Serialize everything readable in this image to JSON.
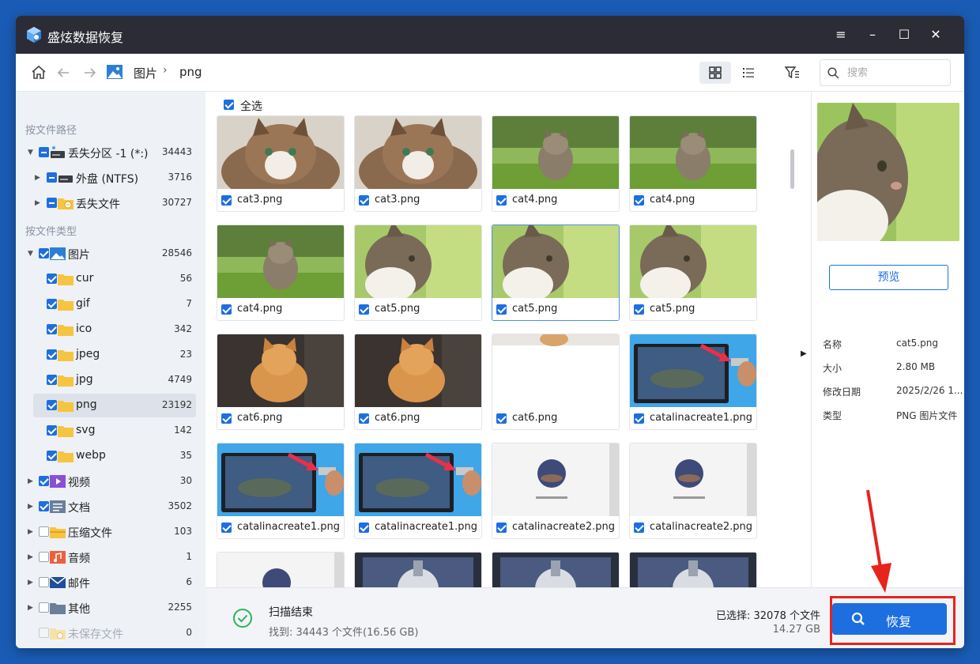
{
  "window": {
    "title": "盛炫数据恢复",
    "controls": [
      "≡",
      "–",
      "☐",
      "✕"
    ]
  },
  "toolbar": {
    "breadcrumb": [
      "图片",
      "png"
    ],
    "search_placeholder": "搜索"
  },
  "sidebar": {
    "path_heading": "按文件路径",
    "type_heading": "按文件类型",
    "path_items": [
      {
        "label": "丢失分区 -1 (*:)",
        "count": "34443"
      },
      {
        "label": "外盘 (NTFS)",
        "count": "3716"
      },
      {
        "label": "丢失文件",
        "count": "30727"
      }
    ],
    "type_items": [
      {
        "label": "图片",
        "count": "28546"
      },
      {
        "label": "cur",
        "count": "56"
      },
      {
        "label": "gif",
        "count": "7"
      },
      {
        "label": "ico",
        "count": "342"
      },
      {
        "label": "jpeg",
        "count": "23"
      },
      {
        "label": "jpg",
        "count": "4749"
      },
      {
        "label": "png",
        "count": "23192"
      },
      {
        "label": "svg",
        "count": "142"
      },
      {
        "label": "webp",
        "count": "35"
      },
      {
        "label": "视频",
        "count": "30"
      },
      {
        "label": "文档",
        "count": "3502"
      },
      {
        "label": "压缩文件",
        "count": "103"
      },
      {
        "label": "音频",
        "count": "1"
      },
      {
        "label": "邮件",
        "count": "6"
      },
      {
        "label": "其他",
        "count": "2255"
      },
      {
        "label": "未保存文件",
        "count": "0"
      }
    ]
  },
  "grid": {
    "select_all_label": "全选",
    "files": [
      "cat3.png",
      "cat3.png",
      "cat4.png",
      "cat4.png",
      "cat4.png",
      "cat5.png",
      "cat5.png",
      "cat5.png",
      "cat6.png",
      "cat6.png",
      "cat6.png",
      "catalinacreate1.png",
      "catalinacreate1.png",
      "catalinacreate1.png",
      "catalinacreate2.png",
      "catalinacreate2.png"
    ]
  },
  "details": {
    "preview_button": "预览",
    "props": [
      {
        "key": "名称",
        "value": "cat5.png"
      },
      {
        "key": "大小",
        "value": "2.80 MB"
      },
      {
        "key": "修改日期",
        "value": "2025/2/26 1..."
      },
      {
        "key": "类型",
        "value": "PNG 图片文件"
      }
    ]
  },
  "status": {
    "title": "扫描结束",
    "found": "找到: 34443 个文件(16.56 GB)",
    "selected": "已选择: 32078 个文件",
    "selected_size": "14.27 GB",
    "recover_label": "恢复"
  },
  "colors": {
    "accent": "#1d6fe0",
    "titlebar": "#2b2c35",
    "annotation": "#e8231c"
  }
}
